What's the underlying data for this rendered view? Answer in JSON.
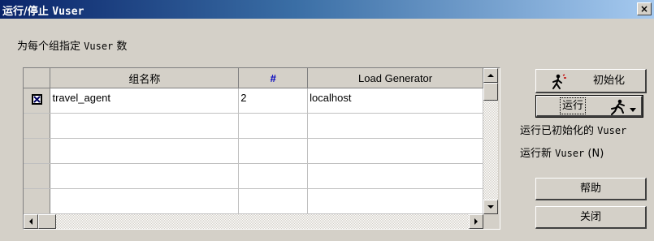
{
  "dialog": {
    "title_prefix": "运行/停止 ",
    "title_mono": "Vuser",
    "close_label": "×"
  },
  "subtitle": {
    "prefix": "为每个组指定 ",
    "mono": "Vuser",
    "suffix": " 数"
  },
  "grid": {
    "columns": [
      "",
      "组名称",
      "#",
      "Load Generator"
    ],
    "rows": [
      {
        "checked": true,
        "name": "travel_agent",
        "count": "2",
        "generator": "localhost"
      },
      {
        "checked": false,
        "name": "",
        "count": "",
        "generator": ""
      },
      {
        "checked": false,
        "name": "",
        "count": "",
        "generator": ""
      },
      {
        "checked": false,
        "name": "",
        "count": "",
        "generator": ""
      },
      {
        "checked": false,
        "name": "",
        "count": "",
        "generator": ""
      },
      {
        "checked": false,
        "name": "",
        "count": "",
        "generator": ""
      }
    ]
  },
  "buttons": {
    "initialize": "初始化",
    "run": "运行",
    "help": "帮助",
    "close": "关闭"
  },
  "menu": {
    "run_initialized_prefix": "运行已初始化的 ",
    "run_initialized_mono": "Vuser",
    "run_new_prefix": "运行新 ",
    "run_new_mono": "Vuser",
    "run_new_suffix": " (N)"
  },
  "icons": {
    "initialize": "walking-figure-icon",
    "run": "running-figure-icon",
    "checkbox": "checkbox-checked-icon"
  }
}
